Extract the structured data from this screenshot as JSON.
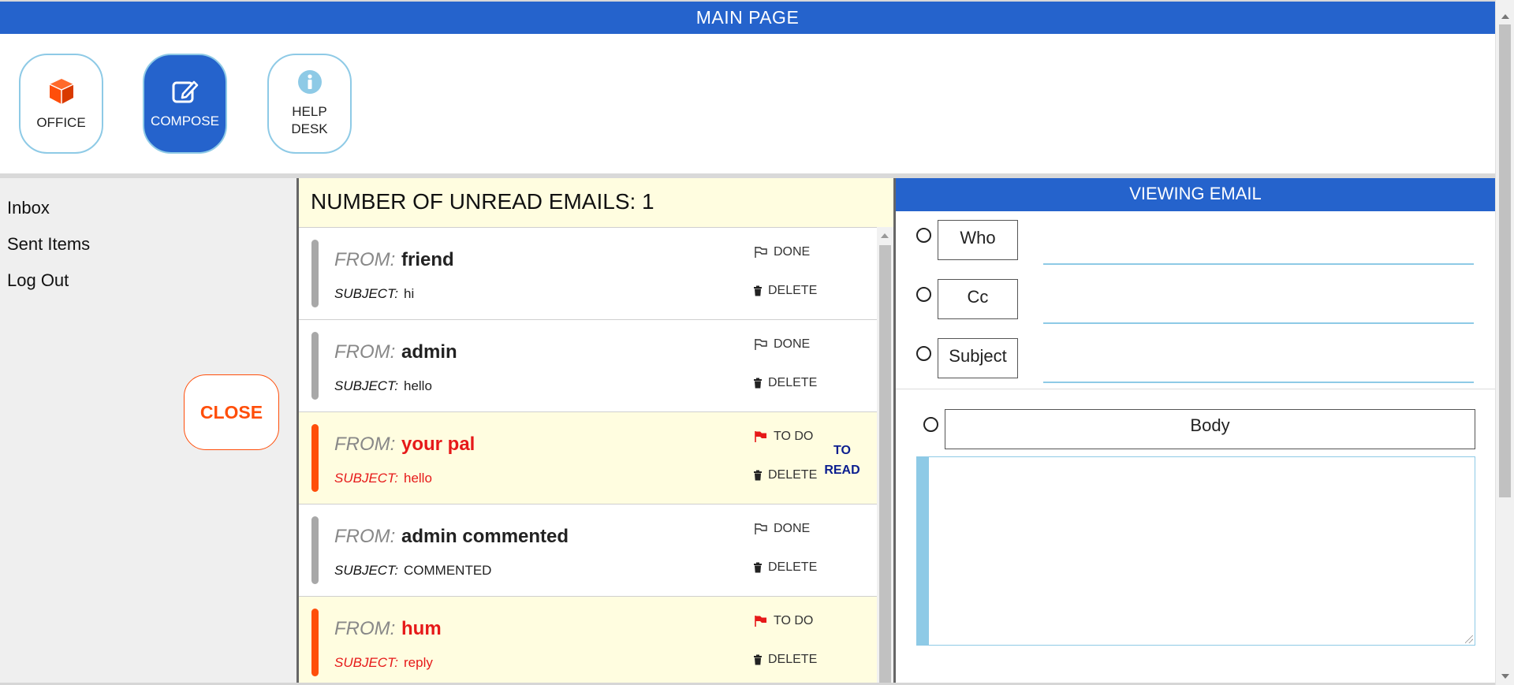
{
  "header": {
    "title": "MAIN PAGE"
  },
  "apps": [
    {
      "label": "OFFICE",
      "icon": "cube-icon"
    },
    {
      "label": "COMPOSE",
      "icon": "edit-icon",
      "active": true
    },
    {
      "label_line1": "HELP",
      "label_line2": "DESK",
      "icon": "info-icon"
    }
  ],
  "sidebar": {
    "items": [
      {
        "label": "Inbox"
      },
      {
        "label": "Sent Items"
      },
      {
        "label": "Log Out"
      }
    ],
    "close_label": "CLOSE"
  },
  "email_list": {
    "unread_header": "NUMBER OF UNREAD EMAILS: 1",
    "from_label": "FROM:",
    "subject_label": "SUBJECT:",
    "delete_label": "DELETE",
    "emails": [
      {
        "from": "friend",
        "subject": "hi",
        "flag_label": "DONE",
        "status": "done"
      },
      {
        "from": "admin",
        "subject": "hello",
        "flag_label": "DONE",
        "status": "done"
      },
      {
        "from": "your pal",
        "subject": "hello",
        "flag_label": "TO DO",
        "status": "todo",
        "badge_line1": "TO",
        "badge_line2": "READ"
      },
      {
        "from": "admin commented",
        "subject": "COMMENTED",
        "flag_label": "DONE",
        "status": "done"
      },
      {
        "from": "hum",
        "subject": "reply",
        "flag_label": "TO DO",
        "status": "todo"
      }
    ]
  },
  "viewer": {
    "title": "VIEWING EMAIL",
    "fields": [
      {
        "label": "Who",
        "value": ""
      },
      {
        "label": "Cc",
        "value": ""
      },
      {
        "label": "Subject",
        "value": ""
      }
    ],
    "body_label": "Body",
    "body_value": ""
  },
  "colors": {
    "primary": "#2563cc",
    "accent_orange": "#ff4e0a",
    "todo_red": "#e61919",
    "light_blue": "#8ecae6",
    "list_bg": "#fffde0"
  }
}
